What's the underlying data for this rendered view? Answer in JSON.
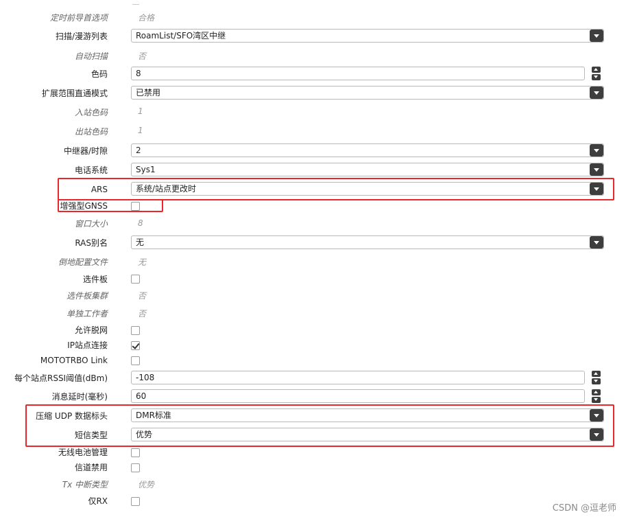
{
  "rows": [
    {
      "label": "定时前导首选项",
      "value": "合格"
    },
    {
      "label": "扫描/漫游列表",
      "value": "RoamList/SFO湾区中继"
    },
    {
      "label": "自动扫描",
      "value": "否"
    },
    {
      "label": "色码",
      "value": "8"
    },
    {
      "label": "扩展范围直通模式",
      "value": "已禁用"
    },
    {
      "label": "入站色码",
      "value": "1"
    },
    {
      "label": "出站色码",
      "value": "1"
    },
    {
      "label": "中继器/时隙",
      "value": "2"
    },
    {
      "label": "电话系统",
      "value": "Sys1"
    },
    {
      "label": "ARS",
      "value": "系统/站点更改时"
    },
    {
      "label": "增强型GNSS"
    },
    {
      "label": "窗口大小",
      "value": "8"
    },
    {
      "label": "RAS别名",
      "value": "无"
    },
    {
      "label": "倒地配置文件",
      "value": "无"
    },
    {
      "label": "选件板"
    },
    {
      "label": "选件板集群",
      "value": "否"
    },
    {
      "label": "单独工作者",
      "value": "否"
    },
    {
      "label": "允许脱网"
    },
    {
      "label": "IP站点连接"
    },
    {
      "label": "MOTOTRBO Link"
    },
    {
      "label": "每个站点RSSI阈值(dBm)",
      "value": "-108"
    },
    {
      "label": "消息延时(毫秒)",
      "value": "60"
    },
    {
      "label": "压缩 UDP 数据标头",
      "value": "DMR标准"
    },
    {
      "label": "短信类型",
      "value": "优势"
    },
    {
      "label": "无线电池管理"
    },
    {
      "label": "信道禁用"
    },
    {
      "label": "Tx 中断类型",
      "value": "优势"
    },
    {
      "label": "仅RX"
    }
  ],
  "checkboxes": {
    "enhanced_gnss": false,
    "option_board": false,
    "allow_offnet": false,
    "ip_site_connect": true,
    "mototrbo_link": false,
    "radio_battery_mgmt": false,
    "channel_disabled": false,
    "rx_only": false
  },
  "colors": {
    "highlight": "#e8262c",
    "dropdown_button": "#3e3e3e",
    "readonly_text": "#999999"
  },
  "watermark": "CSDN @逗老师"
}
